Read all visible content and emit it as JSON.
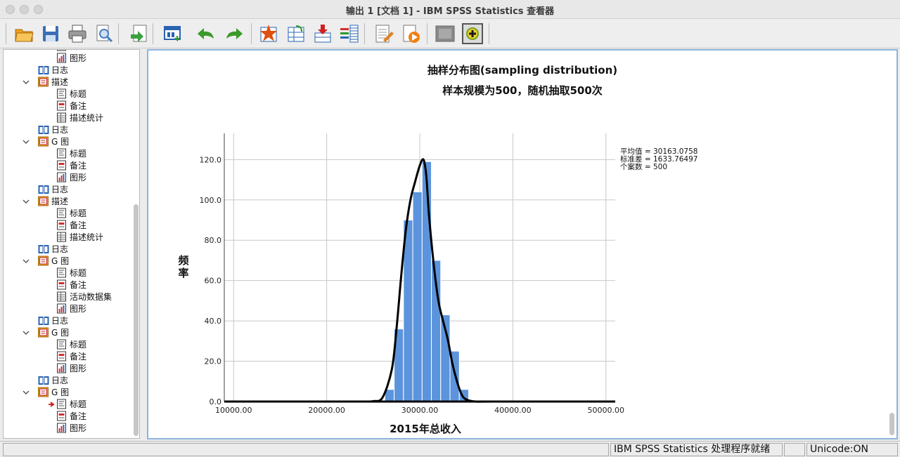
{
  "window": {
    "title": "输出 1 [文档 1] - IBM SPSS Statistics 查看器"
  },
  "toolbar": {
    "buttons": [
      {
        "name": "open-icon",
        "color": "#f0a020"
      },
      {
        "name": "save-icon",
        "color": "#3b6fb5"
      },
      {
        "name": "print-icon",
        "color": "#555555"
      },
      {
        "name": "print-preview-icon",
        "color": "#4a7fc1"
      },
      {
        "name": "export-icon",
        "color": "#3aa040"
      },
      {
        "name": "recall-dialog-icon",
        "color": "#2a63b0"
      },
      {
        "name": "undo-icon",
        "color": "#3a9a2a"
      },
      {
        "name": "redo-icon",
        "color": "#3a9a2a"
      },
      {
        "name": "goto-case-icon",
        "color": "#e05010"
      },
      {
        "name": "goto-variable-icon",
        "color": "#2a63b0"
      },
      {
        "name": "insert-cases-icon",
        "color": "#d02020"
      },
      {
        "name": "variables-icon",
        "color": "#2a63b0"
      },
      {
        "name": "designate-window-icon",
        "color": "#e08020"
      },
      {
        "name": "run-script-icon",
        "color": "#f08010"
      },
      {
        "name": "hide-icon",
        "color": "#8a8a8a"
      },
      {
        "name": "show-icon",
        "color": "#7aa020"
      }
    ]
  },
  "tree": {
    "items": [
      {
        "label": "备注",
        "icon": "notes-icon",
        "level": 2,
        "chevron": false
      },
      {
        "label": "图形",
        "icon": "chart-icon",
        "level": 2,
        "chevron": false
      },
      {
        "label": "日志",
        "icon": "log-icon",
        "level": 1,
        "chevron": false
      },
      {
        "label": "描述",
        "icon": "folder-icon",
        "level": 1,
        "chevron": true
      },
      {
        "label": "标题",
        "icon": "title-icon",
        "level": 2,
        "chevron": false
      },
      {
        "label": "备注",
        "icon": "notes-icon",
        "level": 2,
        "chevron": false
      },
      {
        "label": "描述统计",
        "icon": "table-icon",
        "level": 2,
        "chevron": false
      },
      {
        "label": "日志",
        "icon": "log-icon",
        "level": 1,
        "chevron": false
      },
      {
        "label": "G 图",
        "icon": "folder-icon",
        "level": 1,
        "chevron": true
      },
      {
        "label": "标题",
        "icon": "title-icon",
        "level": 2,
        "chevron": false
      },
      {
        "label": "备注",
        "icon": "notes-icon",
        "level": 2,
        "chevron": false
      },
      {
        "label": "图形",
        "icon": "chart-icon",
        "level": 2,
        "chevron": false
      },
      {
        "label": "日志",
        "icon": "log-icon",
        "level": 1,
        "chevron": false
      },
      {
        "label": "描述",
        "icon": "folder-icon",
        "level": 1,
        "chevron": true
      },
      {
        "label": "标题",
        "icon": "title-icon",
        "level": 2,
        "chevron": false
      },
      {
        "label": "备注",
        "icon": "notes-icon",
        "level": 2,
        "chevron": false
      },
      {
        "label": "描述统计",
        "icon": "table-icon",
        "level": 2,
        "chevron": false
      },
      {
        "label": "日志",
        "icon": "log-icon",
        "level": 1,
        "chevron": false
      },
      {
        "label": "G 图",
        "icon": "folder-icon",
        "level": 1,
        "chevron": true
      },
      {
        "label": "标题",
        "icon": "title-icon",
        "level": 2,
        "chevron": false
      },
      {
        "label": "备注",
        "icon": "notes-icon",
        "level": 2,
        "chevron": false
      },
      {
        "label": "活动数据集",
        "icon": "dataset-icon",
        "level": 2,
        "chevron": false
      },
      {
        "label": "图形",
        "icon": "chart-icon",
        "level": 2,
        "chevron": false
      },
      {
        "label": "日志",
        "icon": "log-icon",
        "level": 1,
        "chevron": false
      },
      {
        "label": "G 图",
        "icon": "folder-icon",
        "level": 1,
        "chevron": true
      },
      {
        "label": "标题",
        "icon": "title-icon",
        "level": 2,
        "chevron": false
      },
      {
        "label": "备注",
        "icon": "notes-icon",
        "level": 2,
        "chevron": false
      },
      {
        "label": "图形",
        "icon": "chart-icon",
        "level": 2,
        "chevron": false
      },
      {
        "label": "日志",
        "icon": "log-icon",
        "level": 1,
        "chevron": false
      },
      {
        "label": "G 图",
        "icon": "folder-icon",
        "level": 1,
        "chevron": true
      },
      {
        "label": "标题",
        "icon": "title-icon",
        "level": 2,
        "chevron": false,
        "current": true
      },
      {
        "label": "备注",
        "icon": "notes-icon",
        "level": 2,
        "chevron": false
      },
      {
        "label": "图形",
        "icon": "chart-icon",
        "level": 2,
        "chevron": false
      }
    ]
  },
  "chart_data": {
    "type": "bar",
    "title": "抽样分布图(sampling distribution)",
    "subtitle": "样本规模为500，随机抽取500次",
    "xlabel": "2015年总收入",
    "ylabel": "频率",
    "xlim": [
      9000,
      51000
    ],
    "ylim": [
      0,
      133
    ],
    "xticks": [
      10000,
      20000,
      30000,
      40000,
      50000
    ],
    "xtick_labels": [
      "10000.00",
      "20000.00",
      "30000.00",
      "40000.00",
      "50000.00"
    ],
    "yticks": [
      0,
      20,
      40,
      60,
      80,
      100,
      120
    ],
    "ytick_labels": [
      "0.0",
      "20.0",
      "40.0",
      "60.0",
      "80.0",
      "100.0",
      "120.0"
    ],
    "grid": true,
    "bar_color": "#5b94dc",
    "bins": [
      {
        "x0": 26250,
        "x1": 27250,
        "value": 6
      },
      {
        "x0": 27250,
        "x1": 28250,
        "value": 36
      },
      {
        "x0": 28250,
        "x1": 29250,
        "value": 90
      },
      {
        "x0": 29250,
        "x1": 30250,
        "value": 104
      },
      {
        "x0": 30250,
        "x1": 31250,
        "value": 119
      },
      {
        "x0": 31250,
        "x1": 32250,
        "value": 70
      },
      {
        "x0": 32250,
        "x1": 33250,
        "value": 43
      },
      {
        "x0": 33250,
        "x1": 34250,
        "value": 25
      },
      {
        "x0": 34250,
        "x1": 35250,
        "value": 6
      }
    ],
    "curve": {
      "type": "normal",
      "x": [
        9000,
        20000,
        24000,
        25000,
        26000,
        27000,
        27500,
        28000,
        28500,
        29000,
        29500,
        30000,
        30400,
        30700,
        31000,
        31500,
        32000,
        32500,
        33000,
        33500,
        34000,
        34500,
        35000,
        36000,
        38000,
        51000
      ],
      "y": [
        0,
        0,
        0,
        0.2,
        2,
        16,
        36,
        62,
        85,
        100,
        109,
        117,
        120,
        112,
        92,
        68,
        50,
        40,
        31,
        19,
        10,
        3.5,
        1,
        0,
        0,
        0
      ]
    },
    "stats": [
      {
        "label": "平均值 = 30163.0758"
      },
      {
        "label": "标准差 = 1633.76497"
      },
      {
        "label": "个案数 = 500"
      }
    ]
  },
  "status": {
    "processor": "IBM SPSS Statistics 处理程序就绪",
    "encoding": "Unicode:ON"
  }
}
